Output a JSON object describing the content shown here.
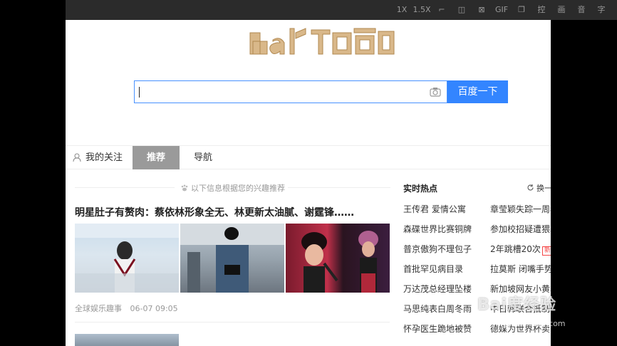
{
  "viewer_toolbar": {
    "items": [
      "1X",
      "1.5X",
      "⌐",
      "◫",
      "⊠",
      "GIF",
      "❐",
      "控",
      "画",
      "音",
      "字"
    ]
  },
  "logo": {
    "alt": "Baidu百度"
  },
  "search": {
    "value": "",
    "button_label": "百度一下"
  },
  "tabs": {
    "follow": "我的关注",
    "recommend": "推荐",
    "nav": "导航"
  },
  "feed": {
    "hint": "以下信息根据您的兴趣推荐",
    "article": {
      "title": "明星肚子有赘肉：蔡依林形象全无、林更新太油腻、谢霆锋……",
      "source": "全球娱乐趣事",
      "time": "06-07 09:05"
    }
  },
  "hot": {
    "title": "实时热点",
    "refresh": "换一",
    "items": [
      [
        "王传君 爱情公寓",
        "章莹颖失踪一周年"
      ],
      [
        "森碟世界比赛铜牌",
        "参加校招疑遭猥亵"
      ],
      [
        "普京傲狗不理包子",
        "2年跳槽20次"
      ],
      [
        "首批罕见病目录",
        "拉莫斯 闭嘴手势"
      ],
      [
        "万达茂总经理坠楼",
        "新加坡网友小黄车"
      ],
      [
        "马思纯表白周冬雨",
        "中日韩联合抵制"
      ],
      [
        "怀孕医生跪地被赞",
        "德媒为世界杯卖"
      ]
    ],
    "new_label": "新"
  },
  "watermark": {
    "text": "Bai度经验",
    "sub": "jingyan.baidu.com"
  }
}
